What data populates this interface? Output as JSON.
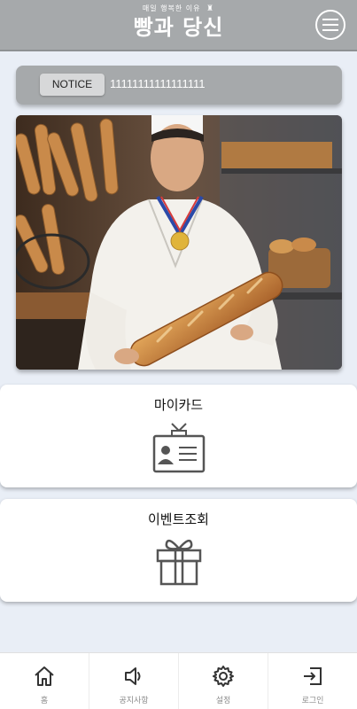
{
  "header": {
    "subtitle": "매일 행복한 이유",
    "title": "빵과 당신",
    "menu_icon": "hamburger-icon"
  },
  "notice": {
    "badge_label": "NOTICE",
    "text": "11111111111111111"
  },
  "hero": {
    "image": "chef-holding-baguette-photo"
  },
  "cards": [
    {
      "title": "마이카드",
      "icon": "id-card-icon"
    },
    {
      "title": "이벤트조회",
      "icon": "gift-icon"
    }
  ],
  "tabbar": {
    "items": [
      {
        "label": "홈",
        "icon": "home-icon"
      },
      {
        "label": "공지사항",
        "icon": "speaker-icon"
      },
      {
        "label": "설정",
        "icon": "gear-icon"
      },
      {
        "label": "로그인",
        "icon": "login-icon"
      }
    ]
  },
  "colors": {
    "header_bg": "#a6a9ab",
    "page_bg": "#e9eef6",
    "card_bg": "#ffffff"
  }
}
